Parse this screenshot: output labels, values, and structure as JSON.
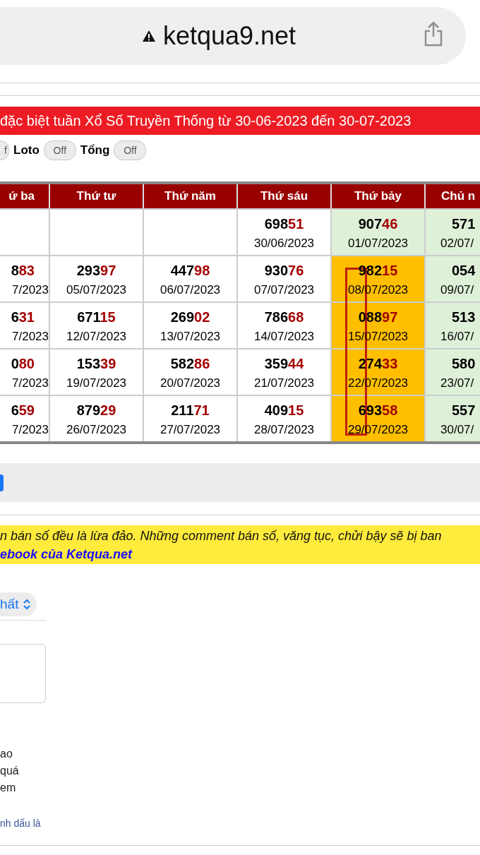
{
  "browser": {
    "url": "ketqua9.net"
  },
  "banner": {
    "title": "đặc biệt tuần Xổ Số Truyền Thống từ 30-06-2023 đến 30-07-2023"
  },
  "toggles": [
    {
      "text": "f",
      "on": false
    },
    {
      "label": "Loto",
      "text": "Off",
      "on": false
    },
    {
      "label": "Tổng",
      "text": "Off",
      "on": false
    }
  ],
  "table": {
    "columns": [
      "ứ ba",
      "Thứ tư",
      "Thứ năm",
      "Thứ sáu",
      "Thứ bảy",
      "Chủ n"
    ],
    "rows": [
      [
        {
          "color": "#ffffff"
        },
        {
          "color": "#ffffff"
        },
        {
          "color": "#ffffff"
        },
        {
          "head": "698",
          "tail": "51",
          "date": "30/06/2023",
          "color": "#ffffff"
        },
        {
          "head": "907",
          "tail": "46",
          "date": "01/07/2023",
          "color": "#dff0d8"
        },
        {
          "head": "571",
          "date": "02/07/",
          "color": "#dff0d8"
        }
      ],
      [
        {
          "head": "8",
          "tail": "83",
          "date": "7/2023",
          "color": "#ffffff"
        },
        {
          "head": "293",
          "tail": "97",
          "date": "05/07/2023",
          "color": "#ffffff"
        },
        {
          "head": "447",
          "tail": "98",
          "date": "06/07/2023",
          "color": "#ffffff"
        },
        {
          "head": "930",
          "tail": "76",
          "date": "07/07/2023",
          "color": "#ffffff"
        },
        {
          "head": "982",
          "tail": "15",
          "date": "08/07/2023",
          "color": "#ffbf00"
        },
        {
          "head": "054",
          "date": "09/07/",
          "color": "#dff0d8"
        }
      ],
      [
        {
          "head": "6",
          "tail": "31",
          "date": "7/2023",
          "color": "#ffffff"
        },
        {
          "head": "671",
          "tail": "15",
          "date": "12/07/2023",
          "color": "#ffffff"
        },
        {
          "head": "269",
          "tail": "02",
          "date": "13/07/2023",
          "color": "#ffffff"
        },
        {
          "head": "786",
          "tail": "68",
          "date": "14/07/2023",
          "color": "#ffffff"
        },
        {
          "head": "088",
          "tail": "97",
          "date": "15/07/2023",
          "color": "#ffbf00"
        },
        {
          "head": "513",
          "date": "16/07/",
          "color": "#dff0d8"
        }
      ],
      [
        {
          "head": "0",
          "tail": "80",
          "date": "7/2023",
          "color": "#ffffff"
        },
        {
          "head": "153",
          "tail": "39",
          "date": "19/07/2023",
          "color": "#ffffff"
        },
        {
          "head": "582",
          "tail": "86",
          "date": "20/07/2023",
          "color": "#ffffff"
        },
        {
          "head": "359",
          "tail": "44",
          "date": "21/07/2023",
          "color": "#ffffff"
        },
        {
          "head": "274",
          "tail": "33",
          "date": "22/07/2023",
          "color": "#ffbf00"
        },
        {
          "head": "580",
          "date": "23/07/",
          "color": "#dff0d8"
        }
      ],
      [
        {
          "head": "6",
          "tail": "59",
          "date": "7/2023",
          "color": "#ffffff"
        },
        {
          "head": "879",
          "tail": "29",
          "date": "26/07/2023",
          "color": "#ffffff"
        },
        {
          "head": "211",
          "tail": "71",
          "date": "27/07/2023",
          "color": "#ffffff"
        },
        {
          "head": "409",
          "tail": "15",
          "date": "28/07/2023",
          "color": "#ffffff"
        },
        {
          "head": "693",
          "tail": "58",
          "date": "29/07/2023",
          "color": "#ffbf00"
        },
        {
          "head": "557",
          "date": "30/07/",
          "color": "#dff0d8"
        }
      ]
    ]
  },
  "notice": {
    "text": "n bán số đều là lừa đảo. Những comment bán số, văng tục, chửi bậy sẽ bị ban",
    "link": "ebook của Ketqua.net"
  },
  "comments": {
    "sort": "hất",
    "lines": [
      "ao",
      "quá",
      "em"
    ],
    "link": "nh dấu là"
  }
}
